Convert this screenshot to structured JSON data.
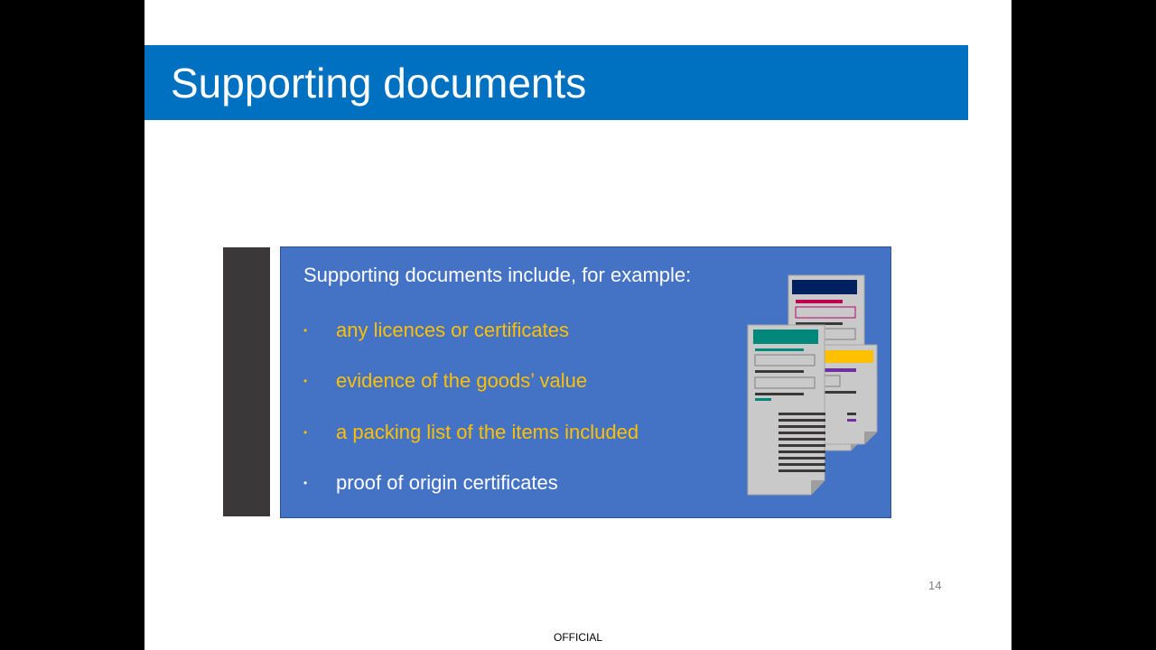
{
  "slide": {
    "title": "Supporting documents",
    "intro": "Supporting documents include, for example:",
    "bullets": [
      {
        "text": "any licences or certificates",
        "color": "#ffc000"
      },
      {
        "text": "evidence of the goods’ value",
        "color": "#ffc000"
      },
      {
        "text": "a packing list of the items included",
        "color": "#ffc000"
      },
      {
        "text": "proof of origin certificates",
        "color": "#ffffff"
      }
    ],
    "illustration_icon": "documents-stack-icon",
    "page_number": "14",
    "classification": "OFFICIAL"
  },
  "colors": {
    "title_bar": "#0070c0",
    "panel": "#4472c4",
    "side_bar": "#3a3838",
    "highlight_text": "#ffc000"
  }
}
